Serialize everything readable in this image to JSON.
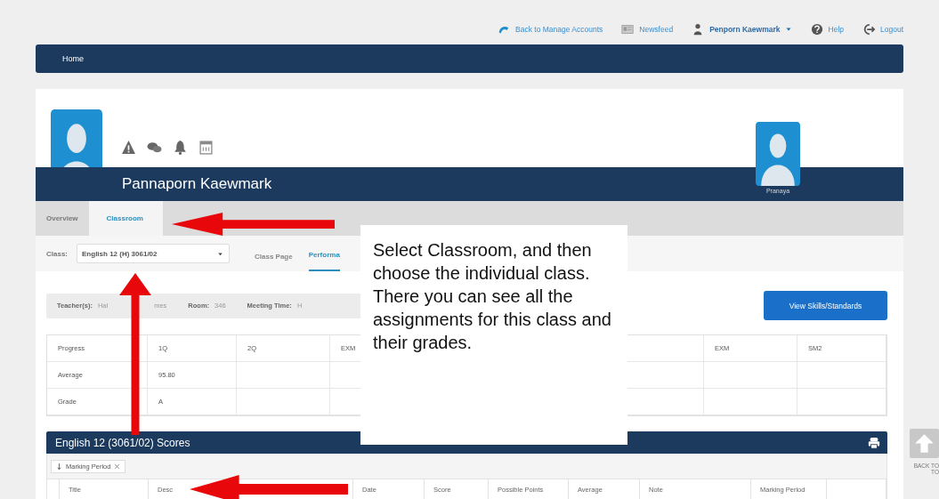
{
  "top_links": [
    {
      "kind": "back",
      "label": "Back to Manage Accounts"
    },
    {
      "kind": "news",
      "label": "Newsfeed"
    },
    {
      "kind": "user",
      "label": "Penporn Kaewmark"
    },
    {
      "kind": "help",
      "label": "Help"
    },
    {
      "kind": "logout",
      "label": "Logout"
    }
  ],
  "nav": {
    "label": "Home"
  },
  "student": {
    "name": "Pannaporn Kaewmark",
    "sibling": "Pranaya"
  },
  "tabs": [
    {
      "label": "Overview",
      "selected": false
    },
    {
      "label": "Classroom",
      "selected": true
    }
  ],
  "class_bar": {
    "label": "Class:",
    "value": "English 12 (H) 3061/02",
    "links": [
      {
        "label": "Class Page",
        "selected": false
      },
      {
        "label": "Performa",
        "selected": true
      }
    ]
  },
  "teacher_bar": [
    {
      "label": "Teacher(s):",
      "value": "Hal"
    },
    {
      "value": "mes"
    },
    {
      "label": "Room:",
      "value": "346"
    },
    {
      "label": "Meeting Time:",
      "value": "H"
    }
  ],
  "skills_button": "View Skills/Standards",
  "progress_table": {
    "columns": [
      "Progress",
      "1Q",
      "2Q",
      "EXM",
      "EXM",
      "SM2"
    ],
    "rows": [
      [
        "Average",
        "95.80"
      ],
      [
        "Grade",
        "A"
      ]
    ]
  },
  "scores": {
    "title": "English 12 (3061/02) Scores",
    "filter": "Marking Period",
    "columns": [
      "Title",
      "Desc",
      "Date",
      "Score",
      "Possible Points",
      "Average",
      "Note",
      "Marking Period"
    ]
  },
  "back_to_top": "BACK TO TO",
  "annotation": {
    "text": "Select Classroom, and then choose the individual class. There you can see all the assignments for this class and their grades."
  }
}
